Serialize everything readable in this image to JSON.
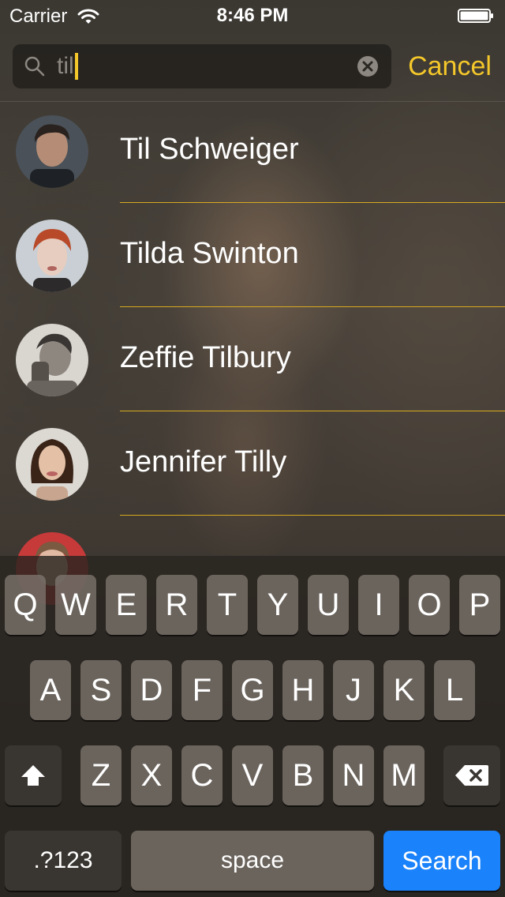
{
  "status_bar": {
    "carrier": "Carrier",
    "time": "8:46 PM"
  },
  "search": {
    "query": "til",
    "cancel_label": "Cancel"
  },
  "colors": {
    "accent": "#f4c72a",
    "divider": "#d8aa1f",
    "search_key": "#1a82fb"
  },
  "results": [
    {
      "name": "Til Schweiger"
    },
    {
      "name": "Tilda Swinton"
    },
    {
      "name": "Zeffie Tilbury"
    },
    {
      "name": "Jennifer Tilly"
    }
  ],
  "keyboard": {
    "row1": [
      "Q",
      "W",
      "E",
      "R",
      "T",
      "Y",
      "U",
      "I",
      "O",
      "P"
    ],
    "row2": [
      "A",
      "S",
      "D",
      "F",
      "G",
      "H",
      "J",
      "K",
      "L"
    ],
    "row3": [
      "Z",
      "X",
      "C",
      "V",
      "B",
      "N",
      "M"
    ],
    "numbers_key": ".?123",
    "space_key": "space",
    "search_key": "Search",
    "shift_icon": "shift-icon",
    "backspace_icon": "backspace-icon"
  }
}
